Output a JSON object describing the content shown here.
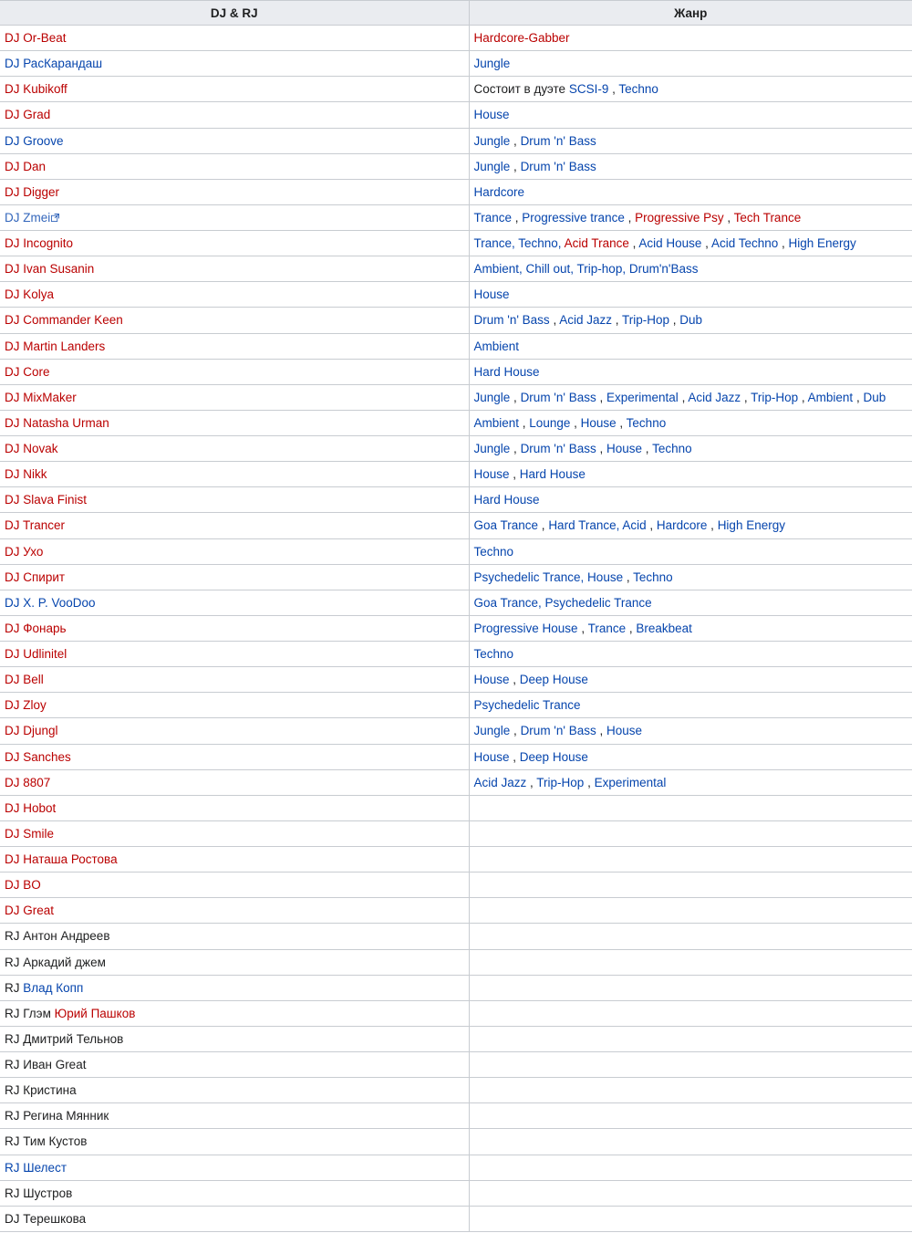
{
  "table": {
    "headers": [
      "DJ & RJ",
      "Жанр"
    ],
    "rows": [
      {
        "dj": [
          [
            "DJ Or-Beat",
            "red"
          ]
        ],
        "genre": [
          [
            "Hardcore-Gabber",
            "red"
          ]
        ]
      },
      {
        "dj": [
          [
            "DJ РасКарандаш",
            "blue"
          ]
        ],
        "genre": [
          [
            "Jungle",
            "blue"
          ]
        ]
      },
      {
        "dj": [
          [
            "DJ Kubikoff",
            "red"
          ]
        ],
        "genre": [
          [
            "Состоит в дуэте ",
            "plain"
          ],
          [
            "SCSI-9",
            "blue"
          ],
          [
            " , ",
            "plain"
          ],
          [
            "Techno",
            "blue"
          ]
        ]
      },
      {
        "dj": [
          [
            "DJ Grad",
            "red"
          ]
        ],
        "genre": [
          [
            "House",
            "blue"
          ]
        ]
      },
      {
        "dj": [
          [
            "DJ Groove",
            "blue"
          ]
        ],
        "genre": [
          [
            "Jungle",
            "blue"
          ],
          [
            " , ",
            "plain"
          ],
          [
            "Drum 'n' Bass",
            "blue"
          ]
        ]
      },
      {
        "dj": [
          [
            "DJ Dan",
            "red"
          ]
        ],
        "genre": [
          [
            "Jungle",
            "blue"
          ],
          [
            " , ",
            "plain"
          ],
          [
            "Drum 'n' Bass",
            "blue"
          ]
        ]
      },
      {
        "dj": [
          [
            "DJ Digger",
            "red"
          ]
        ],
        "genre": [
          [
            "Hardcore",
            "blue"
          ]
        ]
      },
      {
        "dj": [
          [
            "DJ Zmei",
            "ext"
          ]
        ],
        "ext": true,
        "genre": [
          [
            "Trance",
            "blue"
          ],
          [
            " , ",
            "plain"
          ],
          [
            "Progressive trance",
            "blue"
          ],
          [
            " , ",
            "plain"
          ],
          [
            "Progressive Psy",
            "red"
          ],
          [
            " , ",
            "plain"
          ],
          [
            "Tech Trance",
            "red"
          ]
        ]
      },
      {
        "dj": [
          [
            "DJ Incognito",
            "red"
          ]
        ],
        "genre": [
          [
            "Trance, Techno, ",
            "blue"
          ],
          [
            "Acid Trance",
            "red"
          ],
          [
            " , ",
            "plain"
          ],
          [
            "Acid House",
            "blue"
          ],
          [
            " , ",
            "plain"
          ],
          [
            "Acid Techno",
            "blue"
          ],
          [
            " , ",
            "plain"
          ],
          [
            "High Energy",
            "blue"
          ]
        ]
      },
      {
        "dj": [
          [
            "DJ Ivan Susanin",
            "red"
          ]
        ],
        "genre": [
          [
            "Ambient, Chill out, Trip-hop, Drum'n'Bass",
            "blue"
          ]
        ]
      },
      {
        "dj": [
          [
            "DJ Kolya",
            "red"
          ]
        ],
        "genre": [
          [
            "House",
            "blue"
          ]
        ]
      },
      {
        "dj": [
          [
            "DJ Commander Keen",
            "red"
          ]
        ],
        "genre": [
          [
            "Drum 'n' Bass",
            "blue"
          ],
          [
            " , ",
            "plain"
          ],
          [
            "Acid Jazz",
            "blue"
          ],
          [
            " , ",
            "plain"
          ],
          [
            "Trip-Hop",
            "blue"
          ],
          [
            " , ",
            "plain"
          ],
          [
            "Dub",
            "blue"
          ]
        ]
      },
      {
        "dj": [
          [
            "DJ Martin Landers",
            "red"
          ]
        ],
        "genre": [
          [
            "Ambient",
            "blue"
          ]
        ]
      },
      {
        "dj": [
          [
            "DJ Core",
            "red"
          ]
        ],
        "genre": [
          [
            "Hard House",
            "blue"
          ]
        ]
      },
      {
        "dj": [
          [
            "DJ MixMaker",
            "red"
          ]
        ],
        "genre": [
          [
            "Jungle",
            "blue"
          ],
          [
            " , ",
            "plain"
          ],
          [
            "Drum 'n' Bass",
            "blue"
          ],
          [
            " , ",
            "plain"
          ],
          [
            "Experimental",
            "blue"
          ],
          [
            " , ",
            "plain"
          ],
          [
            "Acid Jazz",
            "blue"
          ],
          [
            " , ",
            "plain"
          ],
          [
            "Trip-Hop",
            "blue"
          ],
          [
            " , ",
            "plain"
          ],
          [
            "Ambient",
            "blue"
          ],
          [
            " , ",
            "plain"
          ],
          [
            "Dub",
            "blue"
          ]
        ]
      },
      {
        "dj": [
          [
            "DJ Natasha Urman",
            "red"
          ]
        ],
        "genre": [
          [
            "Ambient",
            "blue"
          ],
          [
            " , ",
            "plain"
          ],
          [
            "Lounge",
            "blue"
          ],
          [
            " , ",
            "plain"
          ],
          [
            "House",
            "blue"
          ],
          [
            " , ",
            "plain"
          ],
          [
            "Techno",
            "blue"
          ]
        ]
      },
      {
        "dj": [
          [
            "DJ Novak",
            "red"
          ]
        ],
        "genre": [
          [
            "Jungle",
            "blue"
          ],
          [
            " , ",
            "plain"
          ],
          [
            "Drum 'n' Bass",
            "blue"
          ],
          [
            " , ",
            "plain"
          ],
          [
            "House",
            "blue"
          ],
          [
            " , ",
            "plain"
          ],
          [
            "Techno",
            "blue"
          ]
        ]
      },
      {
        "dj": [
          [
            "DJ Nikk",
            "red"
          ]
        ],
        "genre": [
          [
            "House",
            "blue"
          ],
          [
            " , ",
            "plain"
          ],
          [
            "Hard House",
            "blue"
          ]
        ]
      },
      {
        "dj": [
          [
            "DJ Slava Finist",
            "red"
          ]
        ],
        "genre": [
          [
            "Hard House",
            "blue"
          ]
        ]
      },
      {
        "dj": [
          [
            "DJ Trancer",
            "red"
          ]
        ],
        "genre": [
          [
            "Goa Trance",
            "blue"
          ],
          [
            " , ",
            "plain"
          ],
          [
            "Hard Trance, Acid",
            "blue"
          ],
          [
            " , ",
            "plain"
          ],
          [
            "Hardcore",
            "blue"
          ],
          [
            " , ",
            "plain"
          ],
          [
            "High Energy",
            "blue"
          ]
        ]
      },
      {
        "dj": [
          [
            "DJ Ухо",
            "red"
          ]
        ],
        "genre": [
          [
            "Techno",
            "blue"
          ]
        ]
      },
      {
        "dj": [
          [
            "DJ Спирит",
            "red"
          ]
        ],
        "genre": [
          [
            "Psychedelic Trance, House",
            "blue"
          ],
          [
            " , ",
            "plain"
          ],
          [
            "Techno",
            "blue"
          ]
        ]
      },
      {
        "dj": [
          [
            "DJ X. P. VooDoo",
            "blue"
          ]
        ],
        "genre": [
          [
            "Goa Trance, Psychedelic Trance",
            "blue"
          ]
        ]
      },
      {
        "dj": [
          [
            "DJ Фонарь",
            "red"
          ]
        ],
        "genre": [
          [
            "Progressive House",
            "blue"
          ],
          [
            " , ",
            "plain"
          ],
          [
            "Trance",
            "blue"
          ],
          [
            " , ",
            "plain"
          ],
          [
            "Breakbeat",
            "blue"
          ]
        ]
      },
      {
        "dj": [
          [
            "DJ Udlinitel",
            "red"
          ]
        ],
        "genre": [
          [
            "Techno",
            "blue"
          ]
        ]
      },
      {
        "dj": [
          [
            "DJ Bell",
            "red"
          ]
        ],
        "genre": [
          [
            "House",
            "blue"
          ],
          [
            " , ",
            "plain"
          ],
          [
            "Deep House",
            "blue"
          ]
        ]
      },
      {
        "dj": [
          [
            "DJ Zloy",
            "red"
          ]
        ],
        "genre": [
          [
            "Psychedelic Trance",
            "blue"
          ]
        ]
      },
      {
        "dj": [
          [
            "DJ Djungl",
            "red"
          ]
        ],
        "genre": [
          [
            "Jungle",
            "blue"
          ],
          [
            " , ",
            "plain"
          ],
          [
            "Drum 'n' Bass",
            "blue"
          ],
          [
            " , ",
            "plain"
          ],
          [
            "House",
            "blue"
          ]
        ]
      },
      {
        "dj": [
          [
            "DJ Sanches",
            "red"
          ]
        ],
        "genre": [
          [
            "House",
            "blue"
          ],
          [
            " , ",
            "plain"
          ],
          [
            "Deep House",
            "blue"
          ]
        ]
      },
      {
        "dj": [
          [
            "DJ 8807",
            "red"
          ]
        ],
        "genre": [
          [
            "Acid Jazz",
            "blue"
          ],
          [
            " , ",
            "plain"
          ],
          [
            "Trip-Hop",
            "blue"
          ],
          [
            " , ",
            "plain"
          ],
          [
            "Experimental",
            "blue"
          ]
        ]
      },
      {
        "dj": [
          [
            "DJ Hobot",
            "red"
          ]
        ],
        "genre": []
      },
      {
        "dj": [
          [
            "DJ Smile",
            "red"
          ]
        ],
        "genre": []
      },
      {
        "dj": [
          [
            "DJ Наташа Ростова",
            "red"
          ]
        ],
        "genre": []
      },
      {
        "dj": [
          [
            "DJ BO",
            "red"
          ]
        ],
        "genre": []
      },
      {
        "dj": [
          [
            "DJ Great",
            "red"
          ]
        ],
        "genre": []
      },
      {
        "dj": [
          [
            "RJ Антон Андреев",
            "plain"
          ]
        ],
        "genre": []
      },
      {
        "dj": [
          [
            "RJ Аркадий джем",
            "plain"
          ]
        ],
        "genre": []
      },
      {
        "dj": [
          [
            "RJ ",
            "plain"
          ],
          [
            "Влад Копп",
            "blue"
          ]
        ],
        "genre": []
      },
      {
        "dj": [
          [
            "RJ Глэм ",
            "plain"
          ],
          [
            "Юрий Пашков",
            "red"
          ]
        ],
        "genre": []
      },
      {
        "dj": [
          [
            "RJ Дмитрий Тельнов",
            "plain"
          ]
        ],
        "genre": []
      },
      {
        "dj": [
          [
            "RJ Иван Great",
            "plain"
          ]
        ],
        "genre": []
      },
      {
        "dj": [
          [
            "RJ Кристина",
            "plain"
          ]
        ],
        "genre": []
      },
      {
        "dj": [
          [
            "RJ Регина Мянник",
            "plain"
          ]
        ],
        "genre": []
      },
      {
        "dj": [
          [
            "RJ Тим Кустов",
            "plain"
          ]
        ],
        "genre": []
      },
      {
        "dj": [
          [
            "RJ Шелест",
            "blue"
          ]
        ],
        "genre": []
      },
      {
        "dj": [
          [
            "RJ Шустров",
            "plain"
          ]
        ],
        "genre": []
      },
      {
        "dj": [
          [
            "DJ Терешкова",
            "plain"
          ]
        ],
        "genre": []
      }
    ]
  }
}
